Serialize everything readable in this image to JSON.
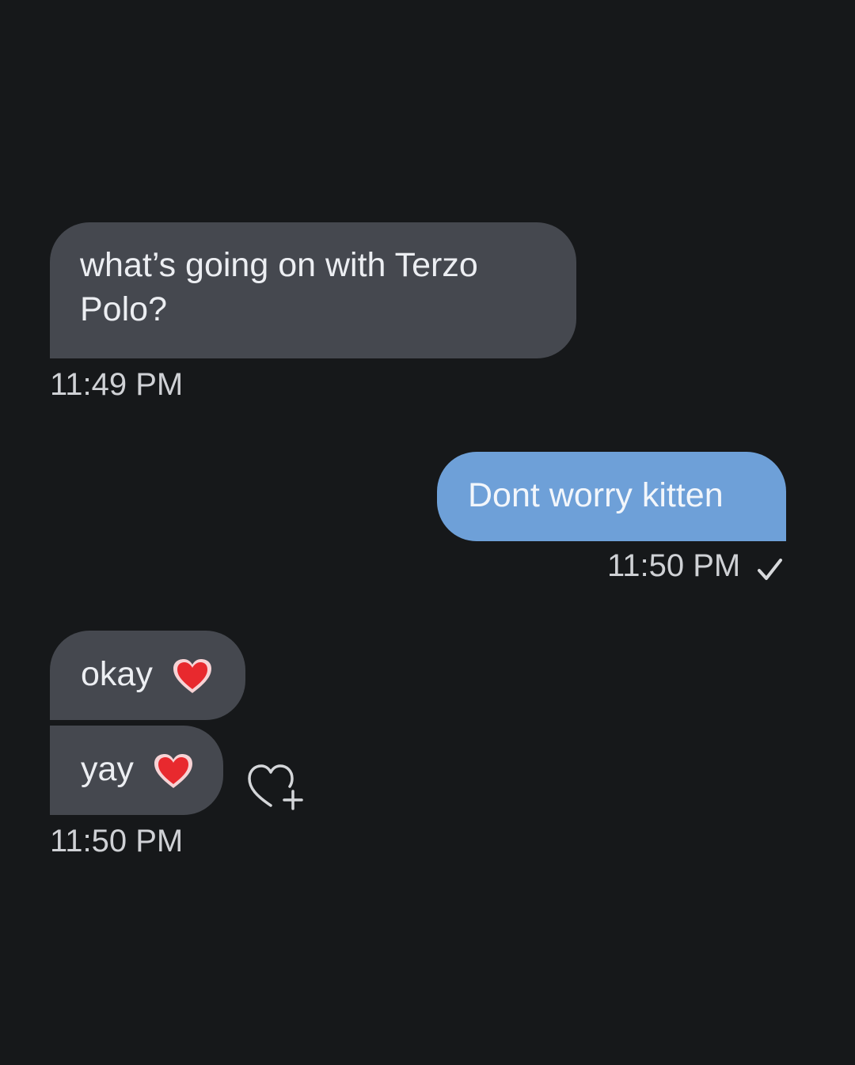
{
  "messages": [
    {
      "direction": "incoming",
      "text": "what’s going on with Terzo Polo?",
      "time": "11:49 PM"
    },
    {
      "direction": "outgoing",
      "text": "Dont worry kitten",
      "time": "11:50 PM",
      "status_icon": "single-check-icon"
    },
    {
      "direction": "incoming",
      "text": "okay",
      "emoji": "red-heart-icon"
    },
    {
      "direction": "incoming",
      "text": "yay",
      "emoji": "red-heart-icon",
      "time": "11:50 PM",
      "action_icon": "add-reaction-heart-icon"
    }
  ],
  "colors": {
    "background": "#16181a",
    "incoming_bubble": "#45484f",
    "outgoing_bubble": "#6ea0d8",
    "timestamp": "#cfd1d5",
    "heart": "#e8292e"
  }
}
